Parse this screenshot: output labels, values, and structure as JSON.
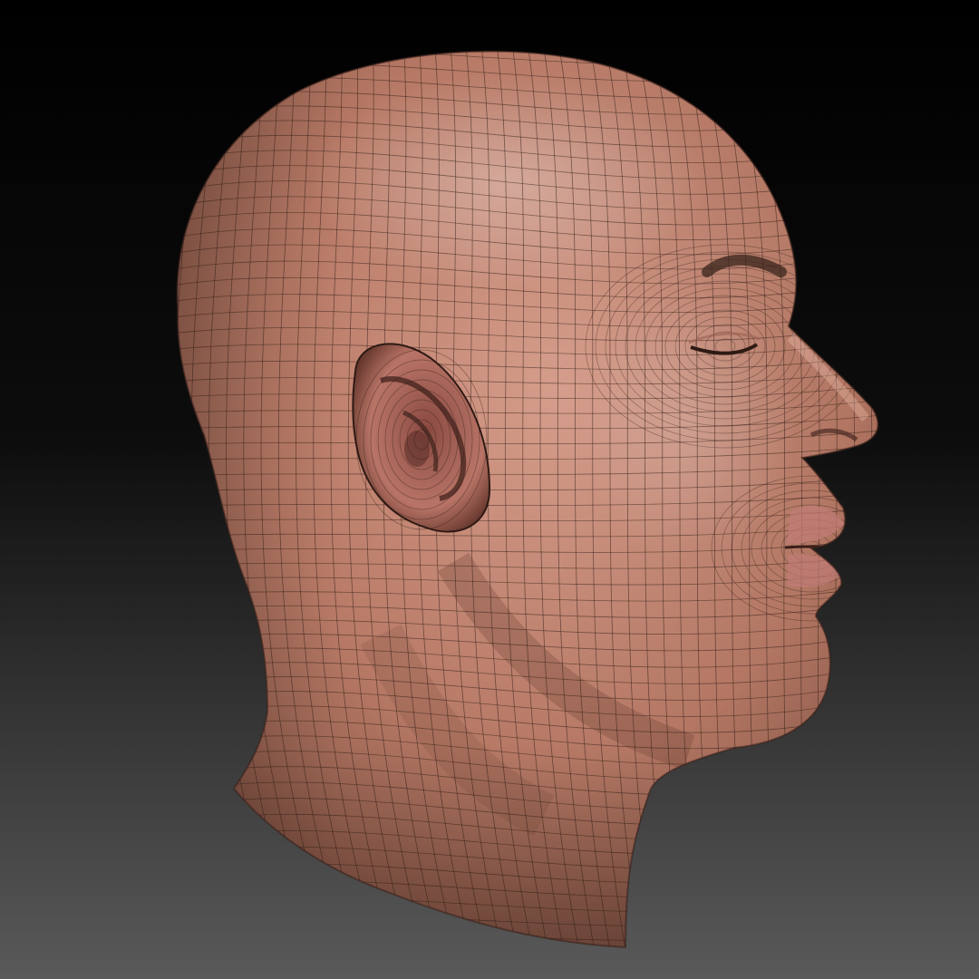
{
  "scene": {
    "subject": "head-mesh",
    "background": {
      "top": "#000000",
      "bottom": "#5a5a5a"
    },
    "skin": {
      "highlight": "#d9a08e",
      "base": "#b87a66",
      "shadow": "#6e4436",
      "lip": "#c07c76"
    },
    "wireframe": {
      "color": "#2a1812"
    }
  }
}
